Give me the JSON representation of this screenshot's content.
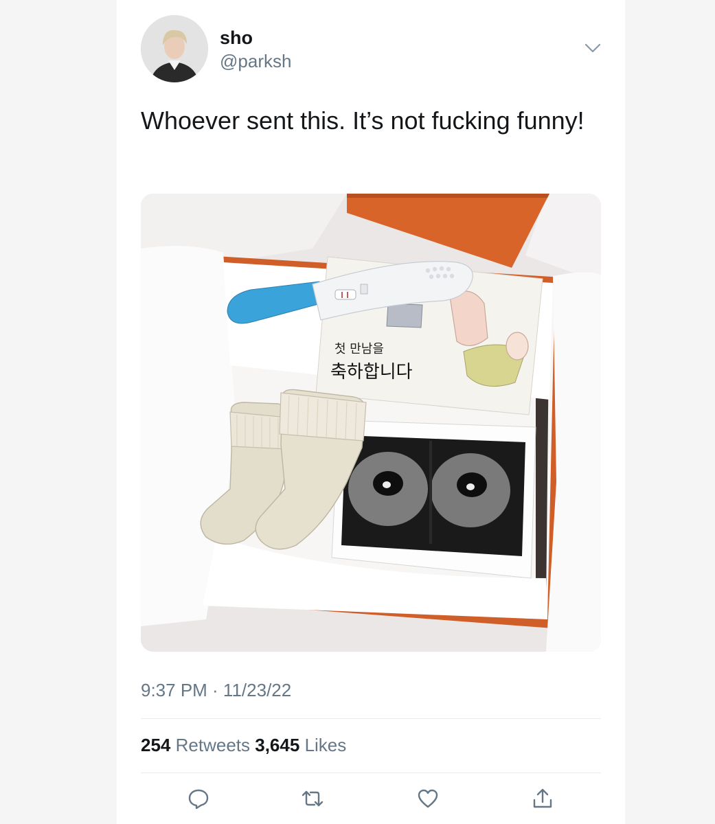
{
  "tweet": {
    "display_name": "sho",
    "handle": "@parksh",
    "text": "Whoever sent this. It’s not fucking funny!",
    "timestamp": "9:37 PM · 11/23/22",
    "retweets_count": "254",
    "retweets_label": "Retweets",
    "likes_count": "3,645",
    "likes_label": "Likes"
  },
  "media": {
    "card_text_line1": "첫 만남을",
    "card_text_line2": "축하합니다"
  },
  "icons": {
    "menu": "chevron-down-icon",
    "reply": "reply-icon",
    "retweet": "retweet-icon",
    "like": "heart-icon",
    "share": "share-icon"
  },
  "colors": {
    "secondary_text": "#657786",
    "primary_text": "#14171a",
    "divider": "#e6ecf0",
    "box_orange": "#d9642a"
  }
}
